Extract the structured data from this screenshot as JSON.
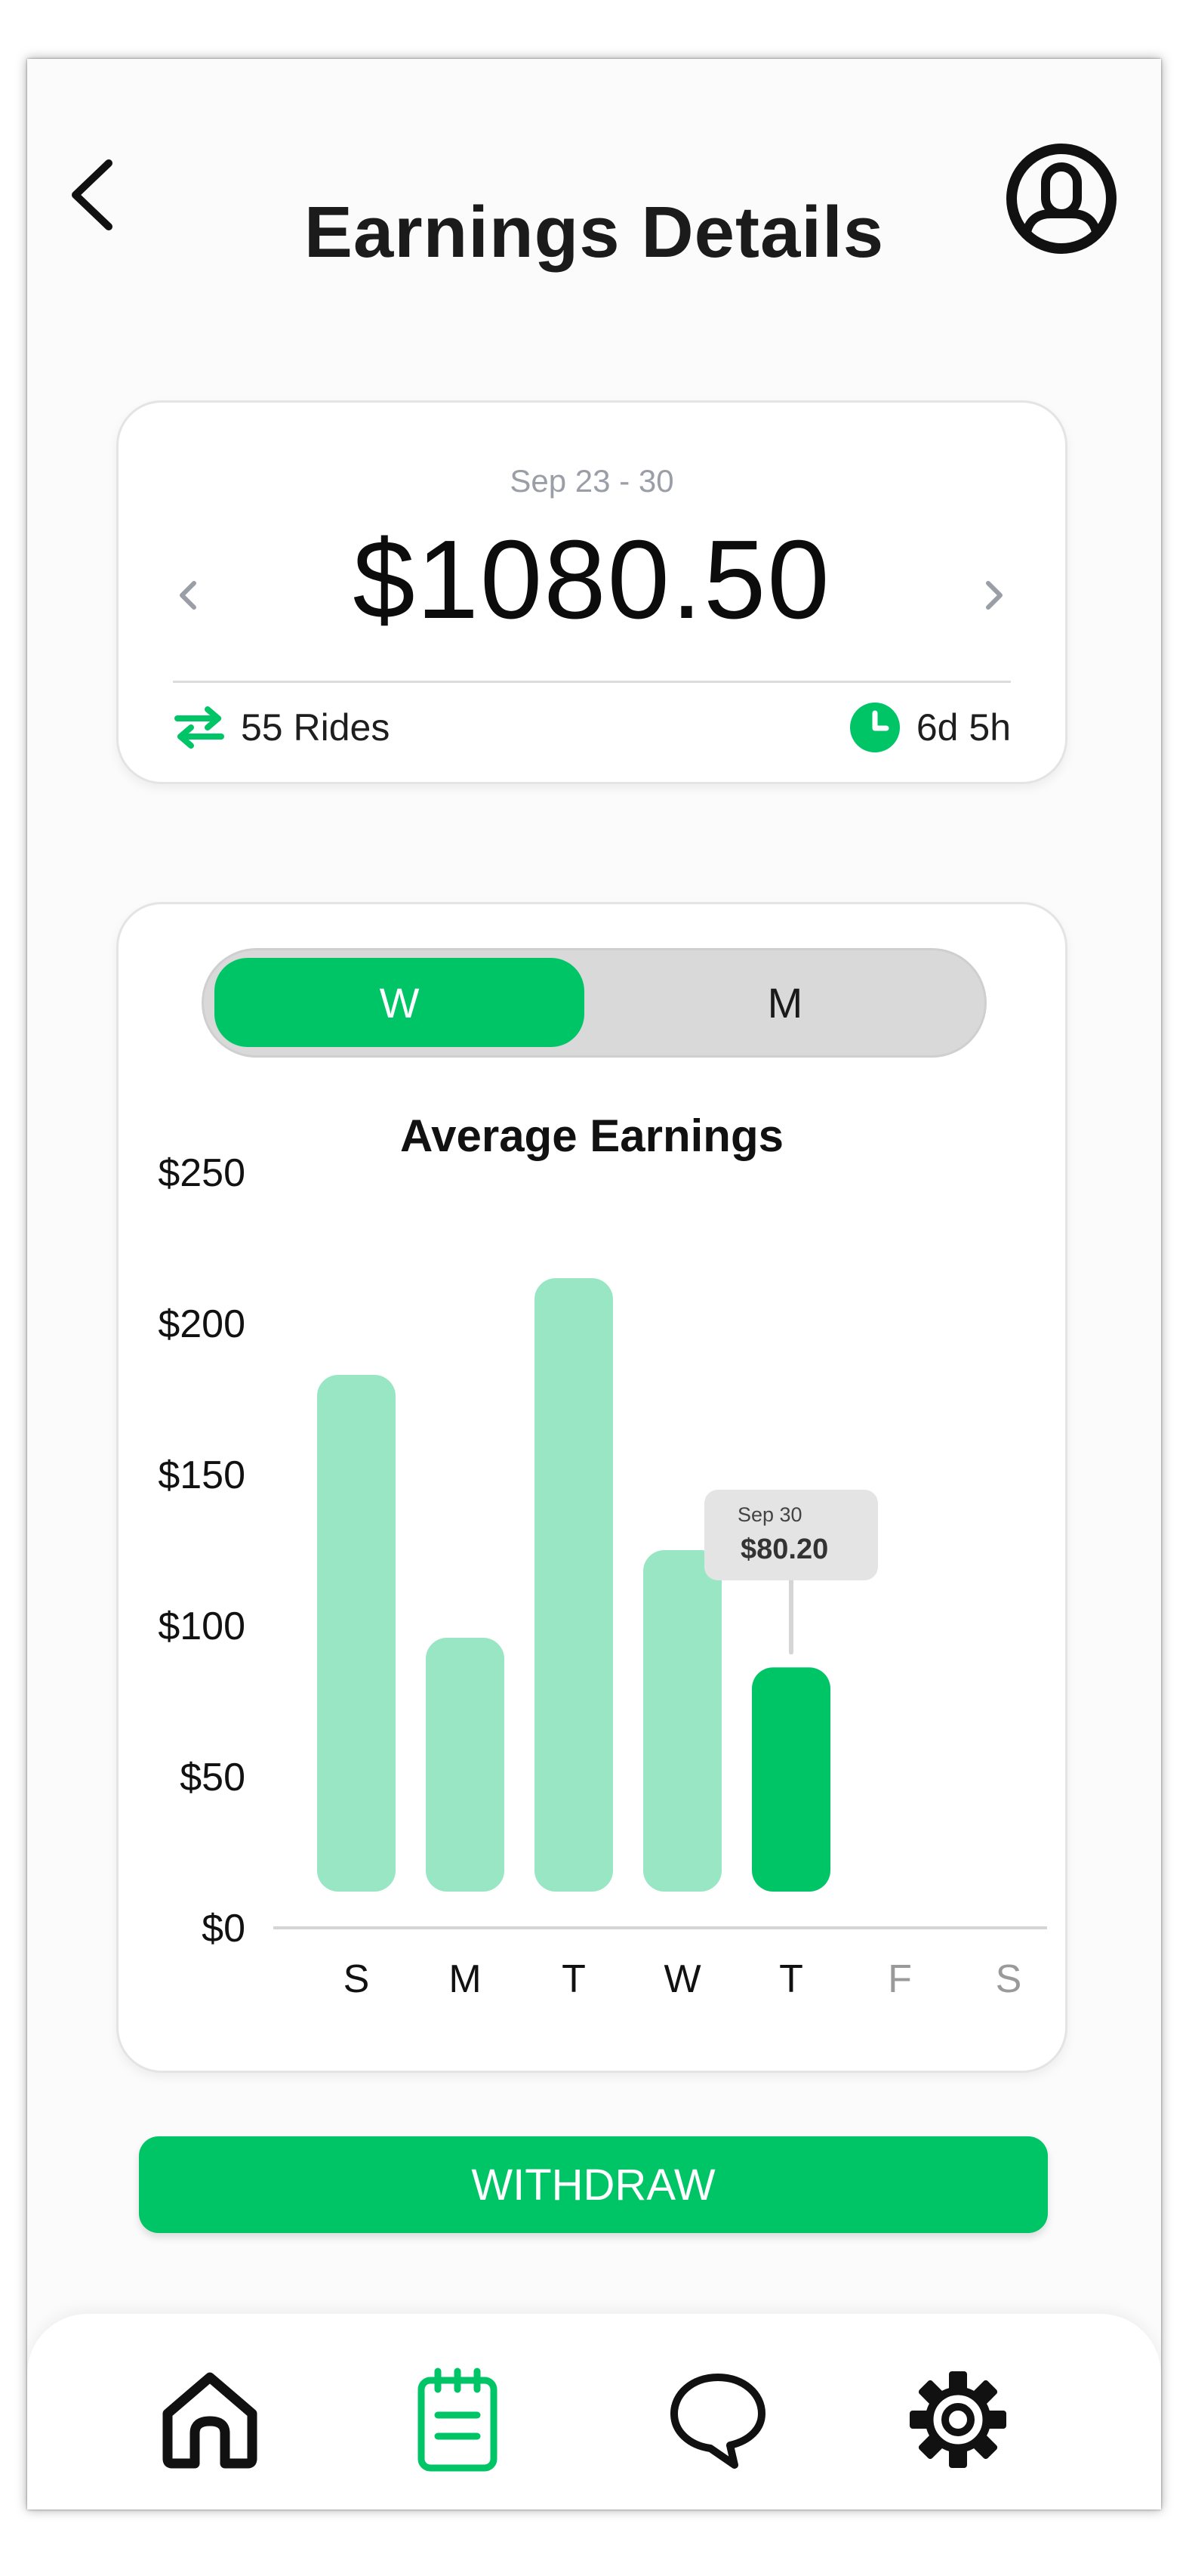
{
  "header": {
    "title": "Earnings Details"
  },
  "summary": {
    "date_range": "Sep 23 - 30",
    "amount": "$1080.50",
    "rides": "55 Rides",
    "time": "6d 5h"
  },
  "toggle": {
    "week_label": "W",
    "month_label": "M",
    "selected": "W"
  },
  "chart_data": {
    "type": "bar",
    "title": "Average Earnings",
    "categories": [
      "S",
      "M",
      "T",
      "W",
      "T",
      "F",
      "S"
    ],
    "values": [
      177,
      90,
      209,
      119,
      80.2,
      null,
      null
    ],
    "highlighted_index": 4,
    "ylim": [
      0,
      250
    ],
    "yticks": [
      "$0",
      "$50",
      "$100",
      "$150",
      "$200",
      "$250"
    ],
    "tooltip": {
      "date": "Sep 30",
      "value": "$80.20"
    },
    "colors": {
      "bar": "#98e6c3",
      "highlight": "#00c567",
      "muted_label": "#9a9a9a"
    }
  },
  "actions": {
    "withdraw_label": "WITHDRAW"
  },
  "colors": {
    "accent": "#00c567"
  },
  "bottom_nav": [
    {
      "icon": "home-icon",
      "active": false
    },
    {
      "icon": "notepad-icon",
      "active": true
    },
    {
      "icon": "chat-icon",
      "active": false
    },
    {
      "icon": "settings-gear-icon",
      "active": false
    }
  ]
}
